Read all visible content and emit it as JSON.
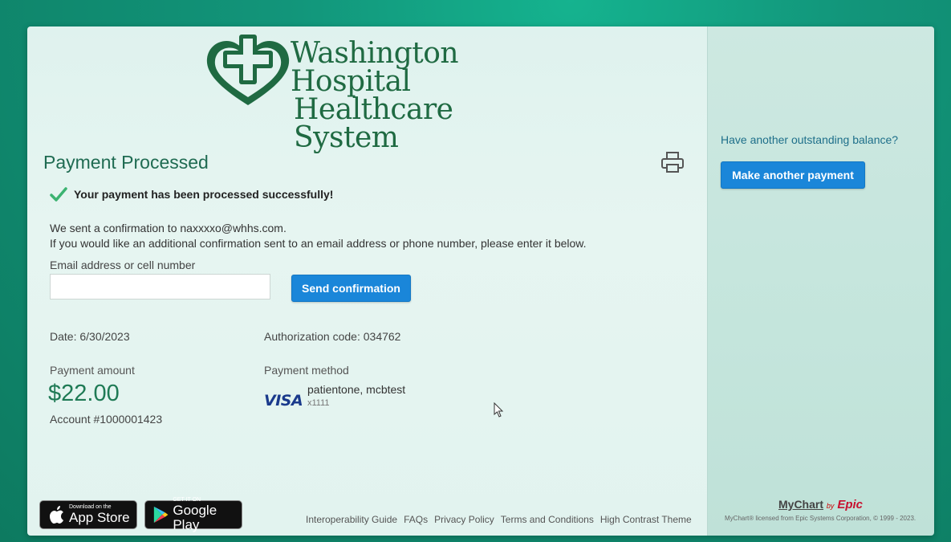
{
  "logo": {
    "line1": "Washington Hospital",
    "line2": "Healthcare System"
  },
  "title": "Payment Processed",
  "success_message": "Your payment has been processed successfully!",
  "confirmation_text": "We sent a confirmation to naxxxxo@whhs.com.",
  "additional_text": "If you would like an additional confirmation sent to an email address or phone number, please enter it below.",
  "email_label": "Email address or cell number",
  "email_value": "",
  "send_button": "Send confirmation",
  "date": "Date:  6/30/2023",
  "authorization": "Authorization code:  034762",
  "payment_amount_label": "Payment amount",
  "payment_amount": "$22.00",
  "account": "Account #1000001423",
  "payment_method_label": "Payment method",
  "card_brand": "VISA",
  "card_name": "patientone, mcbtest",
  "card_last": "x1111",
  "badges": {
    "appstore_small": "Download on the",
    "appstore_big": "App Store",
    "google_small": "GET IT ON",
    "google_big": "Google Play"
  },
  "footer_links": [
    "Interoperability Guide",
    "FAQs",
    "Privacy Policy",
    "Terms and Conditions",
    "High Contrast Theme"
  ],
  "side": {
    "question": "Have another outstanding balance?",
    "button": "Make another payment",
    "mychart": "MyChart",
    "by": "by",
    "epic": "Epic",
    "license": "MyChart® licensed from Epic Systems Corporation, © 1999 - 2023."
  },
  "colors": {
    "accent": "#1a86d9",
    "brand_green": "#1f6a42",
    "success": "#3cb371"
  }
}
